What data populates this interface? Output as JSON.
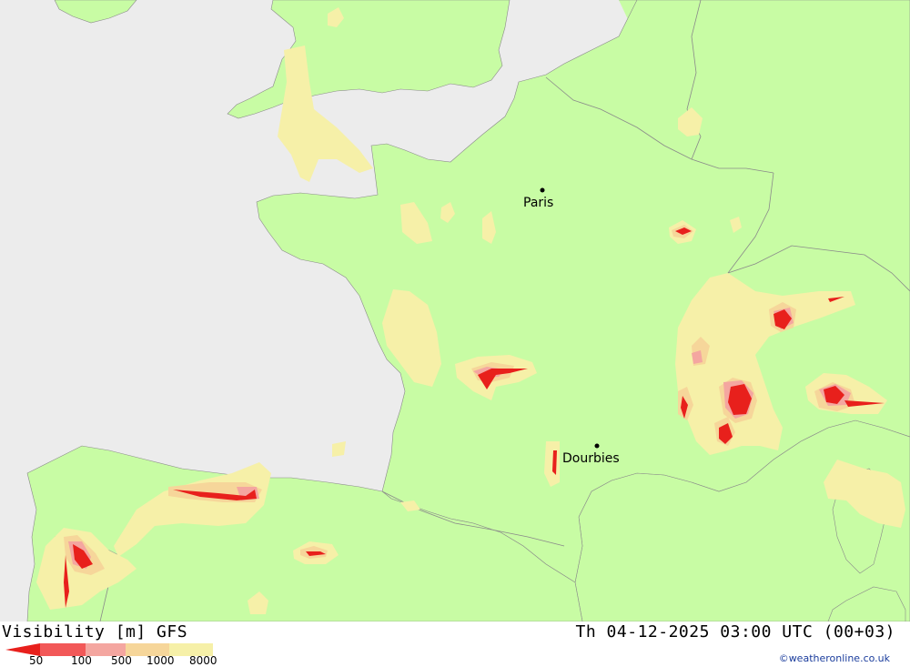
{
  "map": {
    "colors": {
      "sea": "#ececec",
      "land": "#c8fca4",
      "vis_8000": "#f6f0a8",
      "vis_1000": "#f6d69a",
      "vis_500": "#f4a6a0",
      "vis_100": "#f25858",
      "vis_50": "#e8201c",
      "border": "#8a8a8a"
    },
    "cities": [
      {
        "name": "Paris"
      },
      {
        "name": "Dourbies"
      }
    ]
  },
  "header": {
    "title_left": "Visibility [m] GFS",
    "title_right": "Th 04-12-2025 03:00 UTC (00+03)"
  },
  "legend": {
    "labels": [
      "50",
      "100",
      "500",
      "1000",
      "8000"
    ]
  },
  "credit": "©weatheronline.co.uk"
}
